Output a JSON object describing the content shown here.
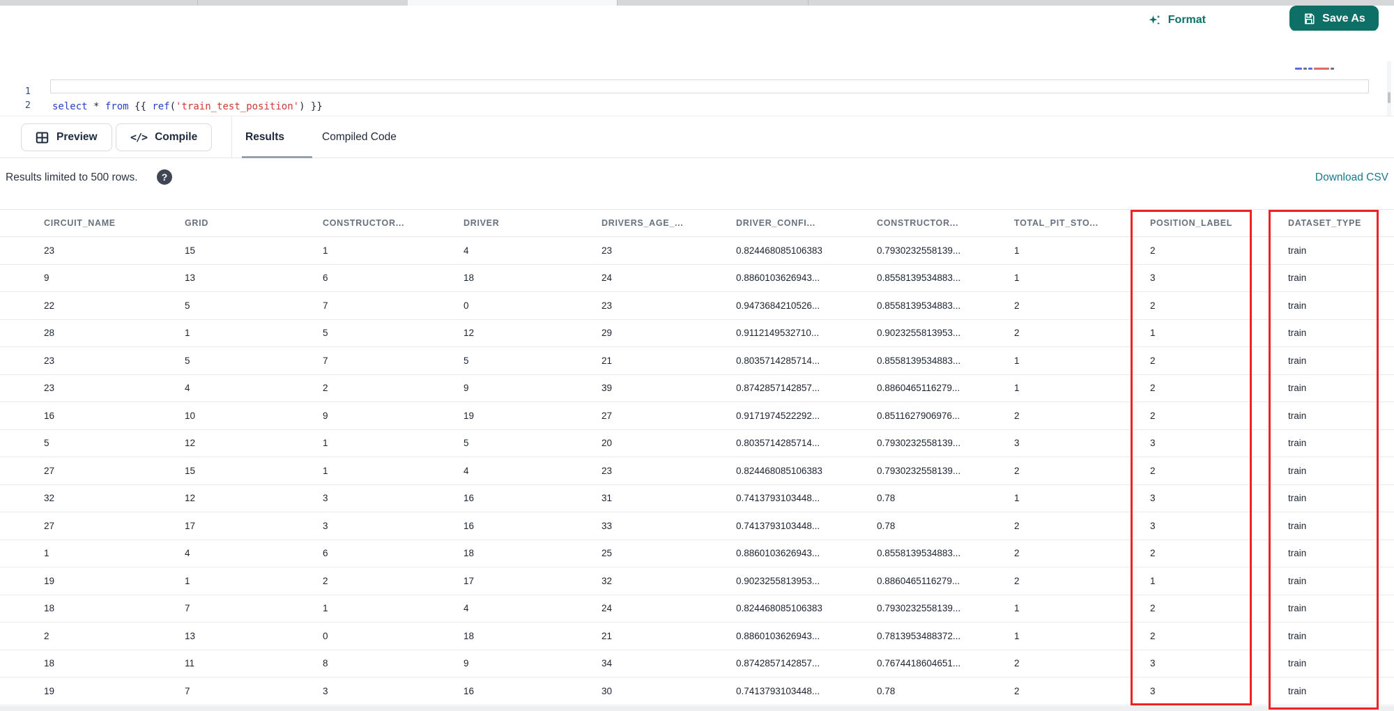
{
  "colors": {
    "teal": "#0d6f66",
    "link_teal": "#18798b",
    "highlight_red": "#ee2222"
  },
  "toolbar": {
    "format_label": "Format",
    "save_as_label": "Save As"
  },
  "editor": {
    "line_numbers": [
      "1",
      "2"
    ],
    "tokens": {
      "kw_select": "select",
      "op_star": " * ",
      "kw_from": "from",
      "brace_open": " {{ ",
      "fn_ref": "ref",
      "paren_open": "(",
      "string_ref": "'train_test_position'",
      "paren_close": ")",
      "brace_close": " }}"
    }
  },
  "actions": {
    "preview_label": "Preview",
    "compile_label": "Compile",
    "compile_glyph": "</>"
  },
  "tabs": [
    {
      "label": "Results",
      "active": true
    },
    {
      "label": "Compiled Code",
      "active": false
    }
  ],
  "status": {
    "message": "Results limited to 500 rows.",
    "help_glyph": "?"
  },
  "download_csv_label": "Download CSV",
  "table": {
    "headers": [
      "CIRCUIT_NAME",
      "GRID",
      "CONSTRUCTOR...",
      "DRIVER",
      "DRIVERS_AGE_...",
      "DRIVER_CONFI...",
      "CONSTRUCTOR...",
      "TOTAL_PIT_STO...",
      "POSITION_LABEL",
      "DATASET_TYPE"
    ],
    "highlighted_columns": [
      "POSITION_LABEL",
      "DATASET_TYPE"
    ],
    "rows": [
      [
        "23",
        "15",
        "1",
        "4",
        "23",
        "0.824468085106383",
        "0.7930232558139...",
        "1",
        "2",
        "train"
      ],
      [
        "9",
        "13",
        "6",
        "18",
        "24",
        "0.8860103626943...",
        "0.8558139534883...",
        "1",
        "3",
        "train"
      ],
      [
        "22",
        "5",
        "7",
        "0",
        "23",
        "0.9473684210526...",
        "0.8558139534883...",
        "2",
        "2",
        "train"
      ],
      [
        "28",
        "1",
        "5",
        "12",
        "29",
        "0.9112149532710...",
        "0.9023255813953...",
        "2",
        "1",
        "train"
      ],
      [
        "23",
        "5",
        "7",
        "5",
        "21",
        "0.8035714285714...",
        "0.8558139534883...",
        "1",
        "2",
        "train"
      ],
      [
        "23",
        "4",
        "2",
        "9",
        "39",
        "0.8742857142857...",
        "0.8860465116279...",
        "1",
        "2",
        "train"
      ],
      [
        "16",
        "10",
        "9",
        "19",
        "27",
        "0.9171974522292...",
        "0.8511627906976...",
        "2",
        "2",
        "train"
      ],
      [
        "5",
        "12",
        "1",
        "5",
        "20",
        "0.8035714285714...",
        "0.7930232558139...",
        "3",
        "3",
        "train"
      ],
      [
        "27",
        "15",
        "1",
        "4",
        "23",
        "0.824468085106383",
        "0.7930232558139...",
        "2",
        "2",
        "train"
      ],
      [
        "32",
        "12",
        "3",
        "16",
        "31",
        "0.7413793103448...",
        "0.78",
        "1",
        "3",
        "train"
      ],
      [
        "27",
        "17",
        "3",
        "16",
        "33",
        "0.7413793103448...",
        "0.78",
        "2",
        "3",
        "train"
      ],
      [
        "1",
        "4",
        "6",
        "18",
        "25",
        "0.8860103626943...",
        "0.8558139534883...",
        "2",
        "2",
        "train"
      ],
      [
        "19",
        "1",
        "2",
        "17",
        "32",
        "0.9023255813953...",
        "0.8860465116279...",
        "2",
        "1",
        "train"
      ],
      [
        "18",
        "7",
        "1",
        "4",
        "24",
        "0.824468085106383",
        "0.7930232558139...",
        "1",
        "2",
        "train"
      ],
      [
        "2",
        "13",
        "0",
        "18",
        "21",
        "0.8860103626943...",
        "0.7813953488372...",
        "1",
        "2",
        "train"
      ],
      [
        "18",
        "11",
        "8",
        "9",
        "34",
        "0.8742857142857...",
        "0.7674418604651...",
        "2",
        "3",
        "train"
      ],
      [
        "19",
        "7",
        "3",
        "16",
        "30",
        "0.7413793103448...",
        "0.78",
        "2",
        "3",
        "train"
      ]
    ]
  }
}
